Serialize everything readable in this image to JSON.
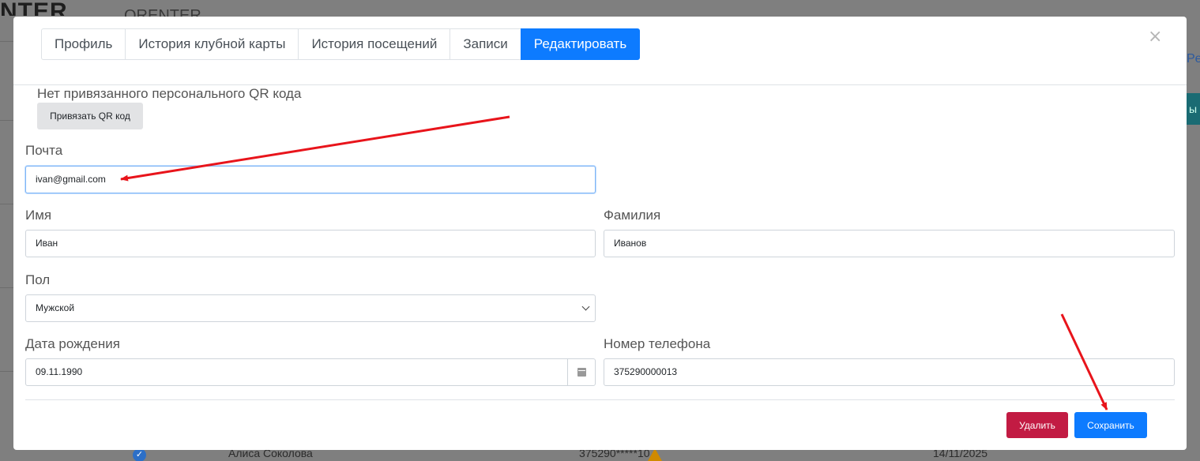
{
  "background": {
    "logo": "NTER",
    "title": "QRENTER",
    "right_link": "Pe",
    "teal_button": "ы",
    "row": {
      "name": "Алиса Соколова",
      "phone": "375290*****10",
      "date": "14/11/2025"
    }
  },
  "modal": {
    "tabs": [
      {
        "label": "Профиль",
        "active": false
      },
      {
        "label": "История клубной карты",
        "active": false
      },
      {
        "label": "История посещений",
        "active": false
      },
      {
        "label": "Записи",
        "active": false
      },
      {
        "label": "Редактировать",
        "active": true
      }
    ],
    "close_label": "×",
    "qr": {
      "text": "Нет привязанного персонального QR кода",
      "button": "Привязать QR код"
    },
    "form": {
      "email": {
        "label": "Почта",
        "value": "ivan@gmail.com"
      },
      "first_name": {
        "label": "Имя",
        "value": "Иван"
      },
      "last_name": {
        "label": "Фамилия",
        "value": "Иванов"
      },
      "gender": {
        "label": "Пол",
        "value": "Мужской"
      },
      "birth_date": {
        "label": "Дата рождения",
        "value": "09.11.1990"
      },
      "phone": {
        "label": "Номер телефона",
        "value": "375290000013"
      }
    },
    "buttons": {
      "delete": "Удалить",
      "save": "Сохранить"
    }
  },
  "colors": {
    "primary": "#0d7bff",
    "danger": "#c21b43",
    "annotation_arrow": "#e8141b"
  }
}
